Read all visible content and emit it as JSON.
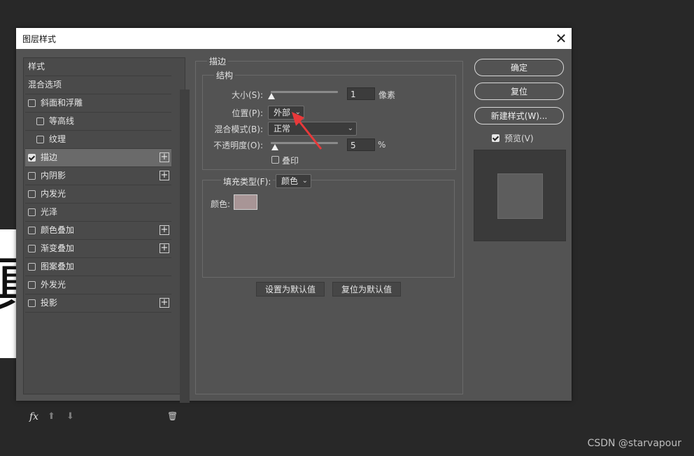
{
  "watermark": "CSDN @starvapour",
  "background_glyph": "真",
  "dialog": {
    "title": "图层样式",
    "close_symbol": "✕"
  },
  "styles_list": {
    "items": [
      {
        "label": "样式",
        "checkbox": false,
        "checked": false,
        "plus": false,
        "indent": false,
        "selected": false
      },
      {
        "label": "混合选项",
        "checkbox": false,
        "checked": false,
        "plus": false,
        "indent": false,
        "selected": false
      },
      {
        "label": "斜面和浮雕",
        "checkbox": true,
        "checked": false,
        "plus": false,
        "indent": false,
        "selected": false
      },
      {
        "label": "等高线",
        "checkbox": true,
        "checked": false,
        "plus": false,
        "indent": true,
        "selected": false
      },
      {
        "label": "纹理",
        "checkbox": true,
        "checked": false,
        "plus": false,
        "indent": true,
        "selected": false
      },
      {
        "label": "描边",
        "checkbox": true,
        "checked": true,
        "plus": true,
        "indent": false,
        "selected": true
      },
      {
        "label": "内阴影",
        "checkbox": true,
        "checked": false,
        "plus": true,
        "indent": false,
        "selected": false
      },
      {
        "label": "内发光",
        "checkbox": true,
        "checked": false,
        "plus": false,
        "indent": false,
        "selected": false
      },
      {
        "label": "光泽",
        "checkbox": true,
        "checked": false,
        "plus": false,
        "indent": false,
        "selected": false
      },
      {
        "label": "颜色叠加",
        "checkbox": true,
        "checked": false,
        "plus": true,
        "indent": false,
        "selected": false
      },
      {
        "label": "渐变叠加",
        "checkbox": true,
        "checked": false,
        "plus": true,
        "indent": false,
        "selected": false
      },
      {
        "label": "图案叠加",
        "checkbox": true,
        "checked": false,
        "plus": false,
        "indent": false,
        "selected": false
      },
      {
        "label": "外发光",
        "checkbox": true,
        "checked": false,
        "plus": false,
        "indent": false,
        "selected": false
      },
      {
        "label": "投影",
        "checkbox": true,
        "checked": false,
        "plus": true,
        "indent": false,
        "selected": false
      }
    ],
    "footer": {
      "fx_label": "fx",
      "up_symbol": "⬆",
      "down_symbol": "⬇",
      "trash_symbol": "🗑"
    }
  },
  "stroke_panel": {
    "section_title": "描边",
    "structure_title": "结构",
    "size_label": "大小(S):",
    "size_value": "1",
    "size_unit": "像素",
    "size_fraction": 0.0,
    "position_label": "位置(P):",
    "position_value": "外部",
    "blend_label": "混合模式(B):",
    "blend_value": "正常",
    "opacity_label": "不透明度(O):",
    "opacity_value": "5",
    "opacity_unit": "%",
    "opacity_fraction": 0.05,
    "overprint_label": "叠印",
    "fill_type_label": "填充类型(F):",
    "fill_type_value": "颜色",
    "color_label": "颜色:",
    "stroke_color": "#a89596",
    "set_default_label": "设置为默认值",
    "reset_default_label": "复位为默认值"
  },
  "actions": {
    "ok_label": "确定",
    "reset_label": "复位",
    "new_style_label": "新建样式(W)...",
    "preview_label": "预览(V)",
    "preview_checked": true
  },
  "colors": {
    "annotation_arrow": "#e8393a",
    "dialog_bg": "#535353"
  }
}
